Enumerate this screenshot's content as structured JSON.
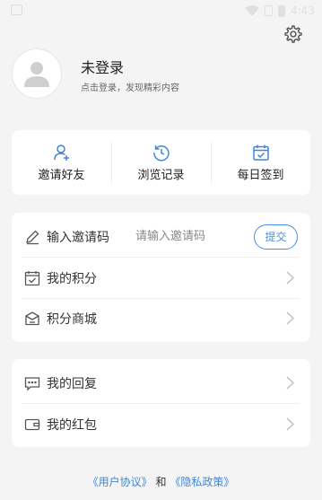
{
  "status_bar": {
    "time": "4:43"
  },
  "profile": {
    "title": "未登录",
    "subtitle": "点击登录，发现精彩内容"
  },
  "quick": [
    {
      "label": "邀请好友",
      "icon": "add-user-icon"
    },
    {
      "label": "浏览记录",
      "icon": "history-icon"
    },
    {
      "label": "每日签到",
      "icon": "calendar-check-icon"
    }
  ],
  "invite": {
    "label": "输入邀请码",
    "placeholder": "请输入邀请码",
    "submit": "提交"
  },
  "menu1": [
    {
      "label": "我的积分",
      "icon": "points-calendar-icon"
    },
    {
      "label": "积分商城",
      "icon": "gift-icon"
    }
  ],
  "menu2": [
    {
      "label": "我的回复",
      "icon": "comment-icon"
    },
    {
      "label": "我的红包",
      "icon": "wallet-icon"
    }
  ],
  "footer": {
    "user_agreement": "《用户协议》",
    "and": "和",
    "privacy": "《隐私政策》"
  },
  "colors": {
    "accent": "#4a90e2",
    "link": "#3f86d8",
    "background": "#f4f4f4"
  }
}
